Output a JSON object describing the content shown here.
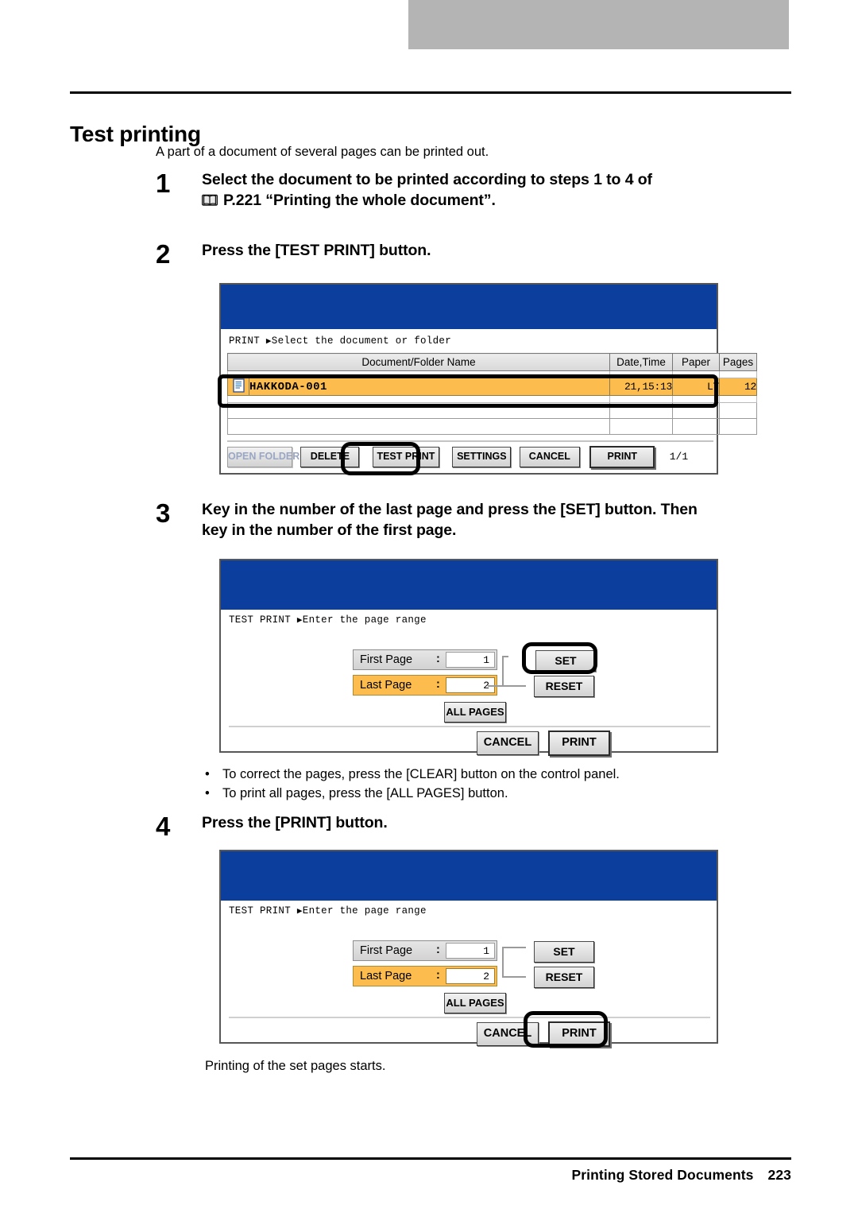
{
  "document": {
    "section_title": "Test printing",
    "intro": "A part of a document of several pages can be printed out.",
    "footer_title": "Printing Stored Documents",
    "footer_page": "223"
  },
  "steps": [
    {
      "number": "1",
      "line1": "Select the document to be printed according to steps 1 to 4 of",
      "line2_ref": "P.221 “Printing the whole document”.",
      "book_icon": "book-icon"
    },
    {
      "number": "2",
      "line1": "Press the [TEST PRINT] button."
    },
    {
      "number": "3",
      "line1": "Key in the number of the last page and press the [SET] button. Then",
      "line2": "key in the number of the first page."
    },
    {
      "number": "4",
      "line1": "Press the [PRINT] button."
    }
  ],
  "notes": [
    "To correct the pages, press the [CLEAR] button on the control panel.",
    "To print all pages, press the [ALL PAGES] button."
  ],
  "caption_after_step4": "Printing of the set pages starts.",
  "panel_print_list": {
    "crumb_label": "PRINT",
    "crumb_arrow": "▶",
    "crumb_text": "Select the document or folder",
    "columns": [
      "Document/Folder Name",
      "Date,Time",
      "Paper",
      "Pages"
    ],
    "selected_row": {
      "icon": "document-icon",
      "name": "HAKKODA-001",
      "date_time": "21,15:13",
      "paper": "LT",
      "pages": "12"
    },
    "buttons": [
      "OPEN FOLDER",
      "DELETE",
      "TEST PRINT",
      "SETTINGS",
      "CANCEL",
      "PRINT"
    ],
    "page_indicator": "1/1",
    "highlighted_button": "TEST PRINT"
  },
  "panel_page_range": {
    "crumb_label": "TEST PRINT",
    "crumb_arrow": "▶",
    "crumb_text": "Enter the page range",
    "first_page_label": "First Page",
    "first_page_value": "1",
    "last_page_label": "Last Page",
    "last_page_value": "2",
    "colon": ":",
    "all_pages_label": "ALL PAGES",
    "set_label": "SET",
    "reset_label": "RESET",
    "cancel_label": "CANCEL",
    "print_label": "PRINT"
  },
  "colors": {
    "panel_header_blue": "#0b3e9d",
    "selection_orange": "#fcbd4e",
    "top_bar_gray": "#b4b4b4",
    "rule_black": "#000000"
  }
}
